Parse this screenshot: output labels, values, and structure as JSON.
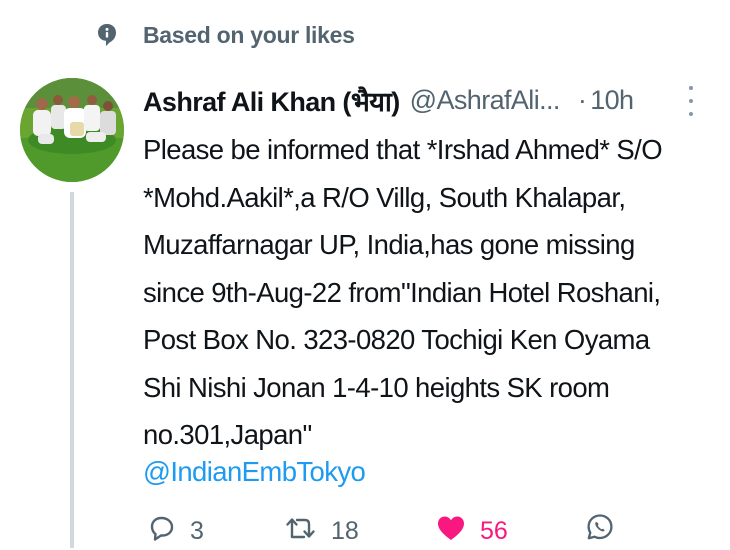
{
  "context": {
    "label": "Based on your likes",
    "icon": "speech-bubble-icon"
  },
  "tweet": {
    "author_name": "Ashraf Ali Khan (भैया)",
    "handle": "@AshrafAli...",
    "separator": "·",
    "time": "10h",
    "text": "Please be informed that *Irshad Ahmed* S/O\n*Mohd.Aakil*,a R/O Villg, South Khalapar,\nMuzaffarnagar UP, India,has gone missing\nsince 9th-Aug-22 from\"Indian Hotel Roshani,\nPost Box No. 323-0820 Tochigi Ken Oyama\nShi Nishi Jonan 1-4-10 heights SK room\nno.301,Japan\"",
    "mention": "@IndianEmbTokyo"
  },
  "actions": {
    "reply_count": "3",
    "retweet_count": "18",
    "like_count": "56",
    "liked": true
  },
  "colors": {
    "text": "#0f1419",
    "secondary": "#536471",
    "link": "#1d9bf0",
    "like": "#f91880",
    "thread_line": "#cfd9de"
  }
}
